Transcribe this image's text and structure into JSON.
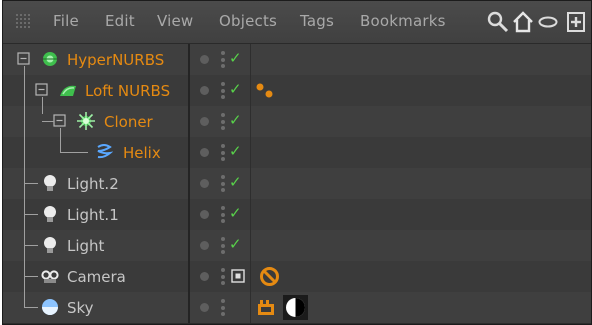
{
  "menubar": {
    "items": [
      "File",
      "Edit",
      "View",
      "Objects",
      "Tags",
      "Bookmarks"
    ]
  },
  "toolbar_icons": [
    "search-icon",
    "home-icon",
    "lens-icon",
    "add-object-icon"
  ],
  "objects": [
    {
      "name": "HyperNURBS",
      "color": "#e58a12",
      "icon": "hypernurbs-icon",
      "enabled_check": "✓",
      "tags": []
    },
    {
      "name": "Loft NURBS",
      "color": "#e58a12",
      "icon": "loft-nurbs-icon",
      "enabled_check": "✓",
      "tags": [
        "phong-tag-icon"
      ]
    },
    {
      "name": "Cloner",
      "color": "#e58a12",
      "icon": "cloner-icon",
      "enabled_check": "✓",
      "tags": []
    },
    {
      "name": "Helix",
      "color": "#e58a12",
      "icon": "helix-icon",
      "enabled_check": "✓",
      "tags": []
    },
    {
      "name": "Light.2",
      "color": "#c6c6c6",
      "icon": "light-icon",
      "enabled_check": "✓",
      "tags": []
    },
    {
      "name": "Light.1",
      "color": "#c6c6c6",
      "icon": "light-icon",
      "enabled_check": "✓",
      "tags": []
    },
    {
      "name": "Light",
      "color": "#c6c6c6",
      "icon": "light-icon",
      "enabled_check": "✓",
      "tags": []
    },
    {
      "name": "Camera",
      "color": "#c6c6c6",
      "icon": "camera-icon",
      "enabled_check": "",
      "tags": [
        "camera-target-tag-icon",
        "protection-tag-icon"
      ]
    },
    {
      "name": "Sky",
      "color": "#c6c6c6",
      "icon": "sky-icon",
      "enabled_check": "",
      "tags": [
        "compositing-tag-icon",
        "display-tag-icon"
      ]
    }
  ],
  "colors": {
    "active_object": "#e58a12",
    "inactive_object": "#c6c6c6",
    "check": "#58d04a",
    "background": "#3a3a3a"
  }
}
